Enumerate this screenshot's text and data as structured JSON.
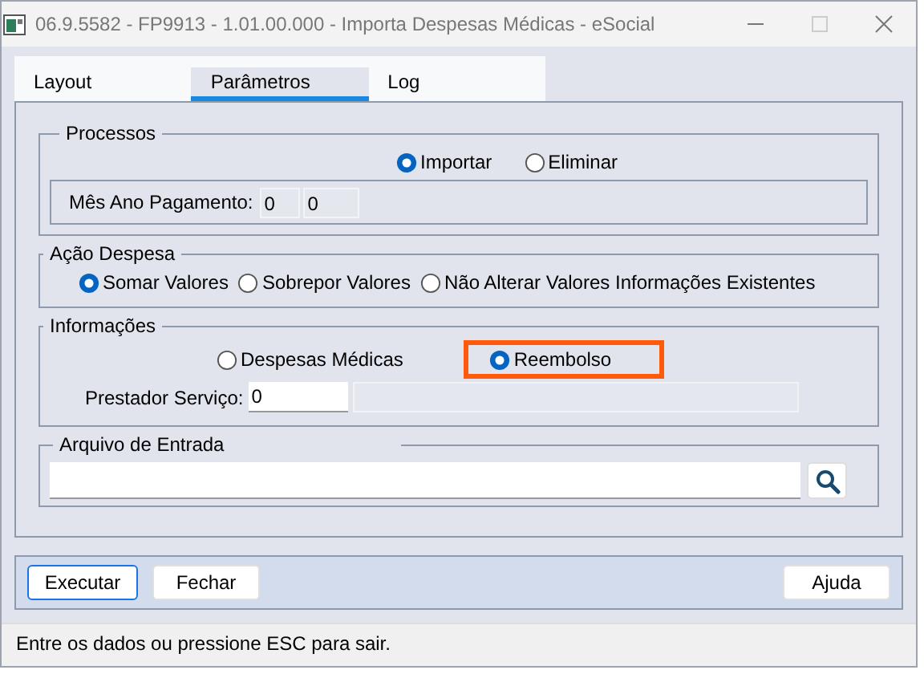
{
  "window": {
    "title": "06.9.5582 - FP9913 - 1.01.00.000 - Importa Despesas Médicas - eSocial"
  },
  "tabs": [
    {
      "label": "Layout",
      "selected": false
    },
    {
      "label": "Parâmetros",
      "selected": true
    },
    {
      "label": "Log",
      "selected": false
    }
  ],
  "processos": {
    "legend": "Processos",
    "options": [
      {
        "label": "Importar",
        "selected": true
      },
      {
        "label": "Eliminar",
        "selected": false
      }
    ],
    "mes_ano": {
      "label": "Mês Ano Pagamento:",
      "values": [
        "0",
        "0"
      ]
    }
  },
  "acao_despesa": {
    "legend": "Ação Despesa",
    "options": [
      {
        "label": "Somar Valores",
        "selected": true
      },
      {
        "label": "Sobrepor Valores",
        "selected": false
      },
      {
        "label": "Não Alterar Valores Informações Existentes",
        "selected": false
      }
    ]
  },
  "informacoes": {
    "legend": "Informações",
    "options": [
      {
        "label": "Despesas Médicas",
        "selected": false,
        "highlighted": false
      },
      {
        "label": "Reembolso",
        "selected": true,
        "highlighted": true
      }
    ],
    "prestador": {
      "label": "Prestador Serviço:",
      "value": "0"
    }
  },
  "arquivo": {
    "legend": "Arquivo de Entrada"
  },
  "buttons_left": [
    {
      "label": "Executar",
      "focused": true
    },
    {
      "label": "Fechar",
      "focused": false
    }
  ],
  "buttons_right": [
    {
      "label": "Ajuda",
      "focused": false
    }
  ],
  "status_bar": "Entre os dados ou pressione ESC para sair."
}
